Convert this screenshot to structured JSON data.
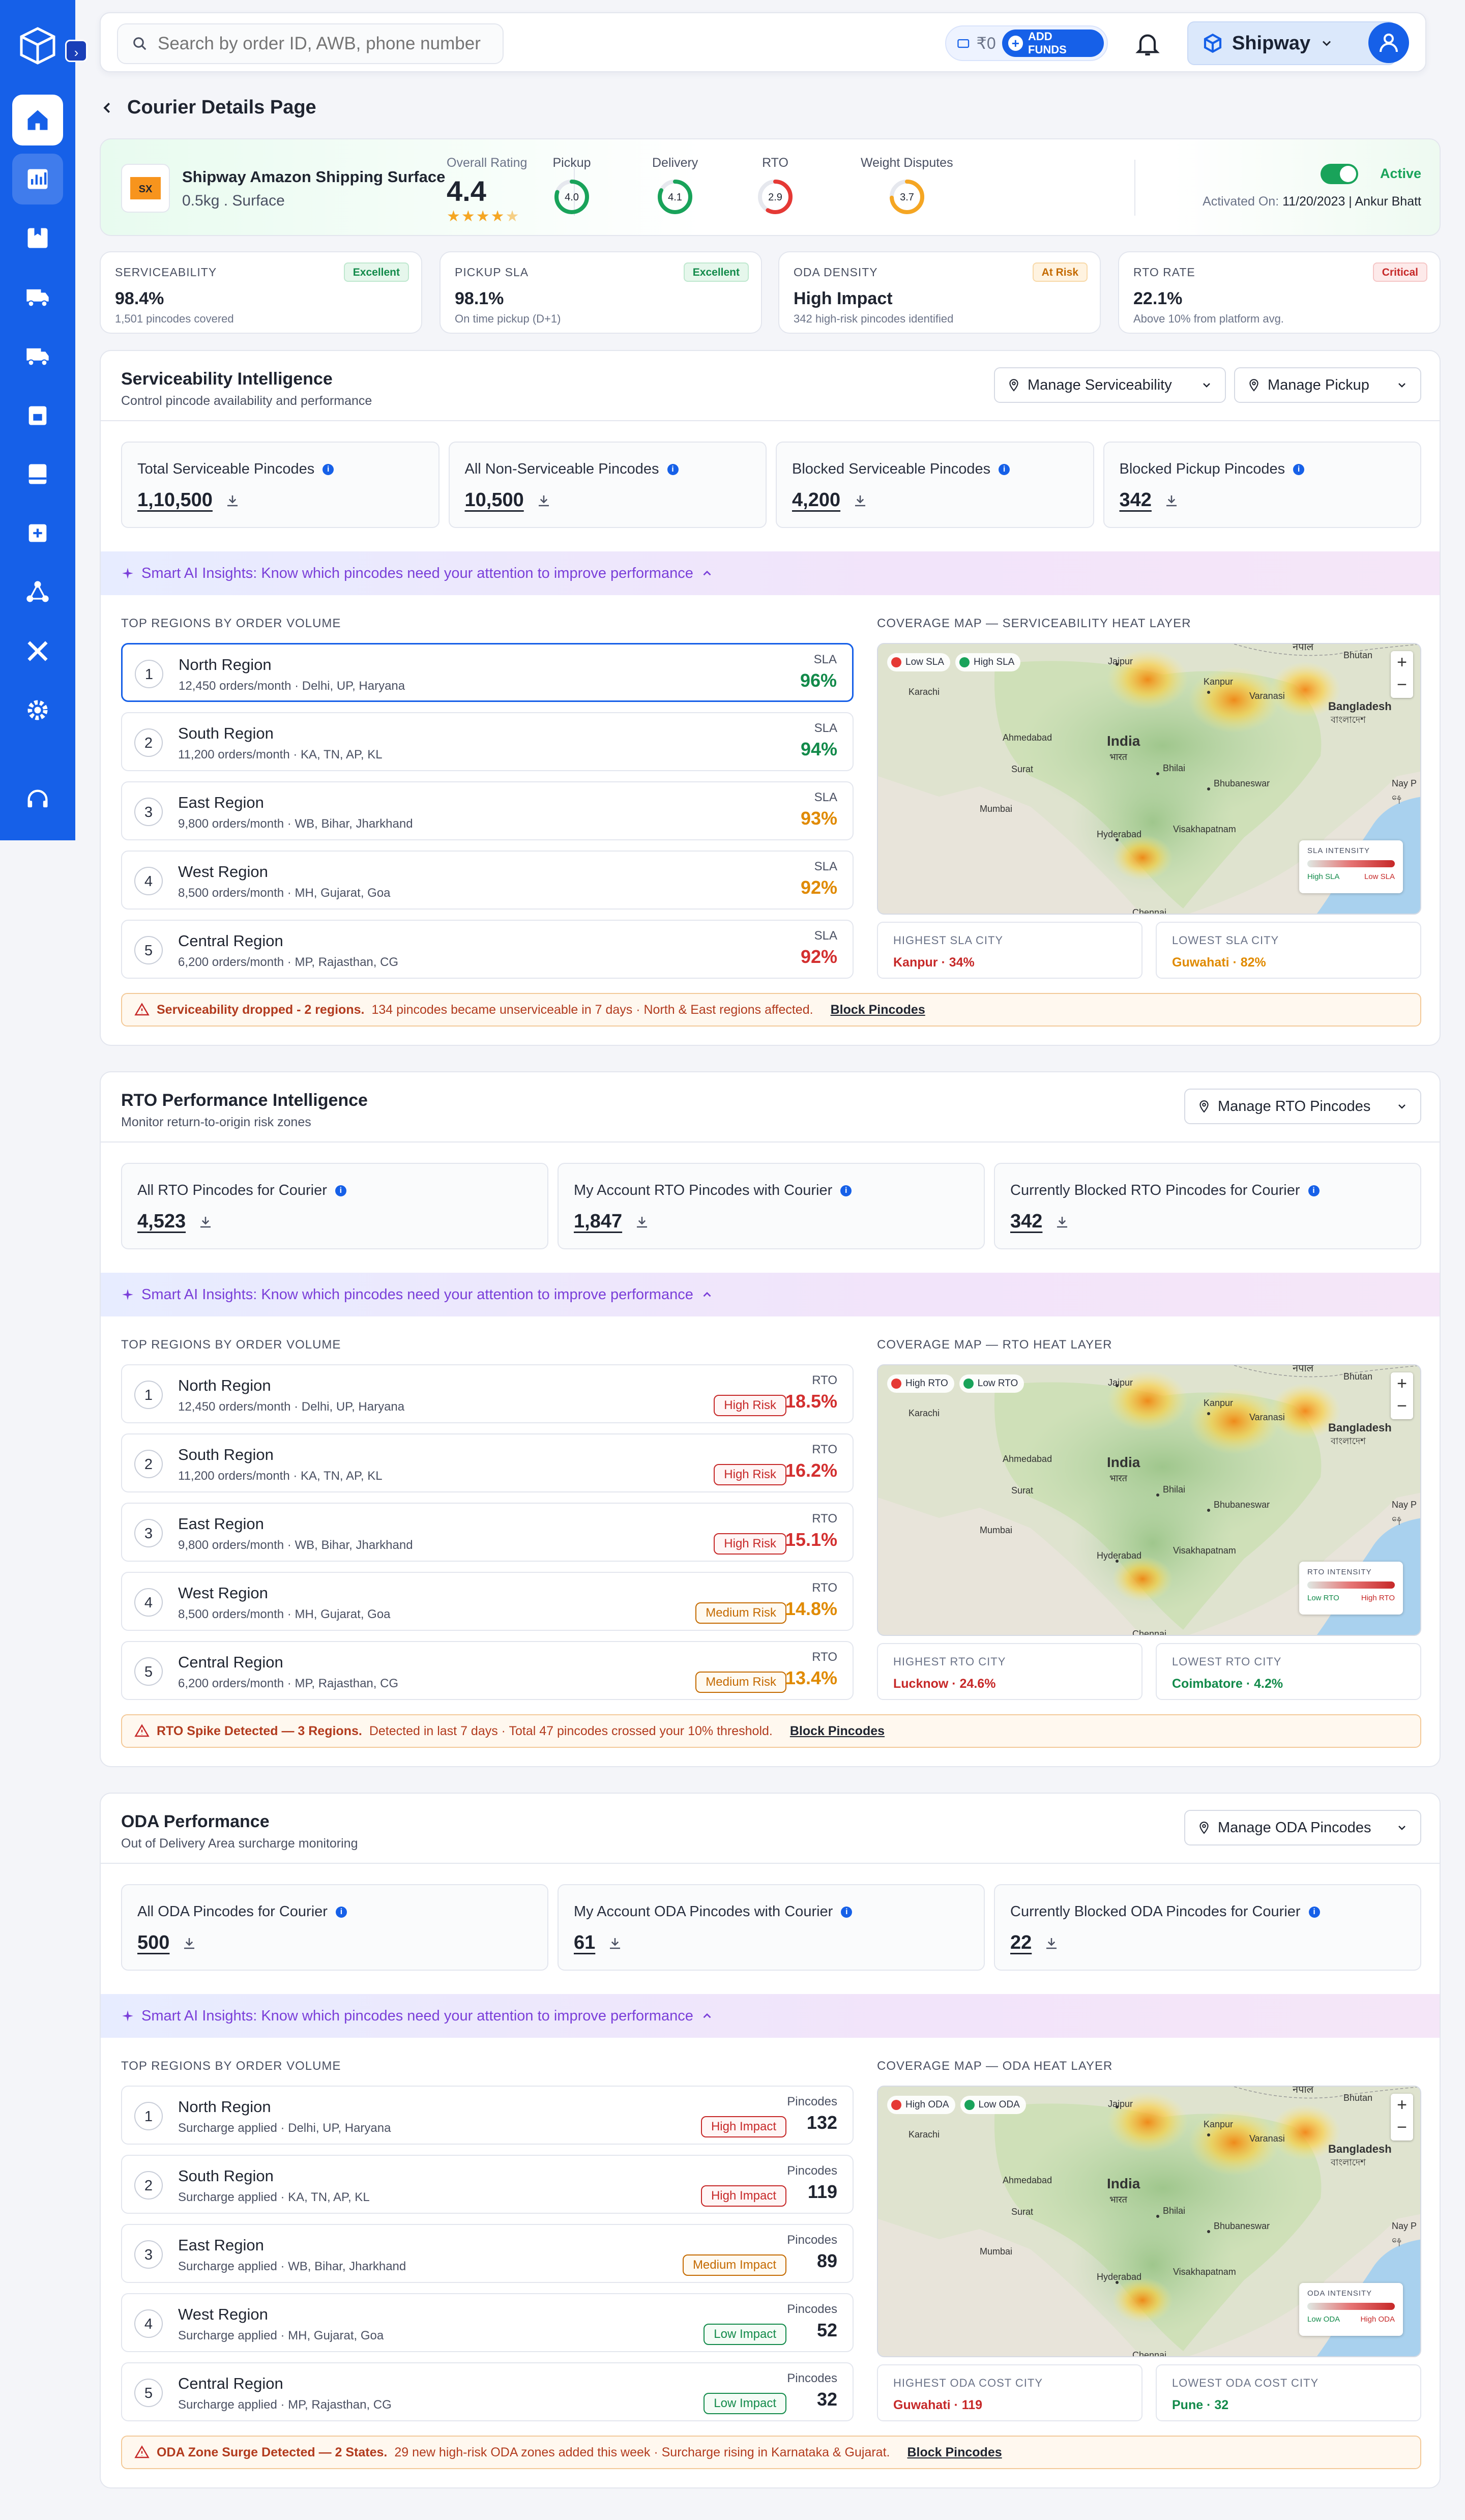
{
  "search": {
    "placeholder": "Search by order ID, AWB, phone number"
  },
  "header": {
    "wallet": "₹0",
    "add_funds": "ADD FUNDS",
    "brand": "Shipway"
  },
  "page_title": "Courier Details Page",
  "courier": {
    "name": "Shipway Amazon Shipping Surface",
    "meta": "0.5kg . Surface",
    "rating_label": "Overall Rating",
    "rating_value": "4.4",
    "rating_stars": 4.5,
    "gauges": [
      {
        "label": "Pickup",
        "value": "4.0",
        "level": 0.8,
        "color": "#19a35a"
      },
      {
        "label": "Delivery",
        "value": "4.1",
        "level": 0.82,
        "color": "#19a35a"
      },
      {
        "label": "RTO",
        "value": "2.9",
        "level": 0.58,
        "color": "#e53935"
      },
      {
        "label": "Weight Disputes",
        "value": "3.7",
        "level": 0.74,
        "color": "#f5a623"
      }
    ],
    "status": "Active",
    "activated_label": "Activated On:",
    "activated_value": "11/20/2023 | Ankur Bhatt"
  },
  "kpis": [
    {
      "title": "SERVICEABILITY",
      "badge": "Excellent",
      "value": "98.4%",
      "sub": "1,501 pincodes covered"
    },
    {
      "title": "PICKUP SLA",
      "badge": "Excellent",
      "value": "98.1%",
      "sub": "On time pickup (D+1)"
    },
    {
      "title": "ODA DENSITY",
      "badge": "At Risk",
      "value": "High Impact",
      "sub": "342 high-risk pincodes identified"
    },
    {
      "title": "RTO RATE",
      "badge": "Critical",
      "value": "22.1%",
      "sub": "Above 10% from platform avg."
    }
  ],
  "ai_text": "Smart AI Insights: Know which pincodes need your attention to improve performance",
  "regions_caption": "TOP REGIONS BY ORDER VOLUME",
  "map_labels": {
    "karachi": "Karachi",
    "jaipur": "Jaipur",
    "nepal": "नेपाल",
    "bhutan": "Bhutan",
    "bangladesh": "Bangladesh",
    "bangladesh_local": "বাংলাদেশ",
    "ahmedabad": "Ahmedabad",
    "india": "India",
    "india_local": "भारत",
    "surat": "Surat",
    "bhilai": "Bhilai",
    "bhubaneswar": "Bhubaneswar",
    "hyderabad": "Hyderabad",
    "visakhapatnam": "Visakhapatnam",
    "kanpur": "Kanpur",
    "varanasi": "Varanasi",
    "nay": "Nay P",
    "nay_local": "နေ",
    "mumbai": "Mumbai",
    "chennai": "Chennai"
  },
  "serviceability": {
    "title": "Serviceability Intelligence",
    "subtitle": "Control pincode availability and performance",
    "btn1": "Manage Serviceability",
    "btn2": "Manage Pickup",
    "stats": [
      {
        "label": "Total Serviceable Pincodes",
        "value": "1,10,500"
      },
      {
        "label": "All Non-Serviceable Pincodes",
        "value": "10,500"
      },
      {
        "label": "Blocked Serviceable Pincodes",
        "value": "4,200"
      },
      {
        "label": "Blocked Pickup Pincodes",
        "value": "342"
      }
    ],
    "map_caption": "COVERAGE MAP — SERVICEABILITY HEAT LAYER",
    "metric_label": "SLA",
    "rows": [
      {
        "n": "1",
        "name": "North Region",
        "sub": "12,450 orders/month · Delhi, UP, Haryana",
        "value": "96%",
        "color": "green"
      },
      {
        "n": "2",
        "name": "South Region",
        "sub": "11,200 orders/month · KA, TN, AP, KL",
        "value": "94%",
        "color": "green"
      },
      {
        "n": "3",
        "name": "East Region",
        "sub": "9,800 orders/month · WB, Bihar, Jharkhand",
        "value": "93%",
        "color": "orange"
      },
      {
        "n": "4",
        "name": "West Region",
        "sub": "8,500 orders/month · MH, Gujarat, Goa",
        "value": "92%",
        "color": "orange"
      },
      {
        "n": "5",
        "name": "Central Region",
        "sub": "6,200 orders/month · MP, Rajasthan, CG",
        "value": "92%",
        "color": "red"
      }
    ],
    "legend": [
      {
        "label": "Low SLA",
        "color": "#e53935"
      },
      {
        "label": "High SLA",
        "color": "#19a35a"
      }
    ],
    "intensity": {
      "title": "SLA INTENSITY",
      "lo": "High SLA",
      "hi": "Low SLA"
    },
    "city1": {
      "title": "HIGHEST SLA CITY",
      "value": "Kanpur · 34%",
      "color": "#c62828"
    },
    "city2": {
      "title": "LOWEST SLA CITY",
      "value": "Guwahati · 82%",
      "color": "#e08a00"
    },
    "alert_bold": "Serviceability dropped - 2 regions.",
    "alert_text": "134 pincodes became unserviceable in 7 days · North & East regions affected.",
    "alert_link": "Block Pincodes"
  },
  "rto": {
    "title": "RTO Performance Intelligence",
    "subtitle": "Monitor return-to-origin risk zones",
    "btn1": "Manage RTO Pincodes",
    "stats": [
      {
        "label": "All RTO Pincodes for Courier",
        "value": "4,523"
      },
      {
        "label": "My Account RTO Pincodes with Courier",
        "value": "1,847"
      },
      {
        "label": "Currently Blocked RTO Pincodes for Courier",
        "value": "342"
      }
    ],
    "map_caption": "COVERAGE MAP — RTO HEAT LAYER",
    "metric_label": "RTO",
    "rows": [
      {
        "n": "1",
        "name": "North Region",
        "sub": "12,450 orders/month · Delhi, UP, Haryana",
        "pill": "High Risk",
        "pillc": "red",
        "value": "18.5%",
        "color": "red"
      },
      {
        "n": "2",
        "name": "South Region",
        "sub": "11,200 orders/month · KA, TN, AP, KL",
        "pill": "High Risk",
        "pillc": "red",
        "value": "16.2%",
        "color": "red"
      },
      {
        "n": "3",
        "name": "East Region",
        "sub": "9,800 orders/month · WB, Bihar, Jharkhand",
        "pill": "High Risk",
        "pillc": "red",
        "value": "15.1%",
        "color": "red"
      },
      {
        "n": "4",
        "name": "West Region",
        "sub": "8,500 orders/month · MH, Gujarat, Goa",
        "pill": "Medium Risk",
        "pillc": "org",
        "value": "14.8%",
        "color": "orange"
      },
      {
        "n": "5",
        "name": "Central Region",
        "sub": "6,200 orders/month · MP, Rajasthan, CG",
        "pill": "Medium Risk",
        "pillc": "org",
        "value": "13.4%",
        "color": "orange"
      }
    ],
    "legend": [
      {
        "label": "High RTO",
        "color": "#e53935"
      },
      {
        "label": "Low RTO",
        "color": "#19a35a"
      }
    ],
    "intensity": {
      "title": "RTO INTENSITY",
      "lo": "Low RTO",
      "hi": "High RTO"
    },
    "city1": {
      "title": "HIGHEST RTO CITY",
      "value": "Lucknow · 24.6%",
      "color": "#c62828"
    },
    "city2": {
      "title": "LOWEST RTO CITY",
      "value": "Coimbatore · 4.2%",
      "color": "#128a4a"
    },
    "alert_bold": "RTO Spike Detected — 3 Regions.",
    "alert_text": "Detected in last 7 days · Total 47 pincodes crossed your 10% threshold.",
    "alert_link": "Block Pincodes"
  },
  "oda": {
    "title": "ODA Performance",
    "subtitle": "Out of Delivery Area surcharge monitoring",
    "btn1": "Manage ODA Pincodes",
    "stats": [
      {
        "label": "All ODA Pincodes for Courier",
        "value": "500"
      },
      {
        "label": "My Account ODA Pincodes with Courier",
        "value": "61"
      },
      {
        "label": "Currently Blocked ODA Pincodes for Courier",
        "value": "22"
      }
    ],
    "map_caption": "COVERAGE MAP — ODA HEAT LAYER",
    "metric_label": "Pincodes",
    "rows": [
      {
        "n": "1",
        "name": "North Region",
        "sub": "Surcharge applied · Delhi, UP, Haryana",
        "pill": "High Impact",
        "pillc": "red",
        "value": "132",
        "color": "dark"
      },
      {
        "n": "2",
        "name": "South Region",
        "sub": "Surcharge applied · KA, TN, AP, KL",
        "pill": "High Impact",
        "pillc": "red",
        "value": "119",
        "color": "dark"
      },
      {
        "n": "3",
        "name": "East Region",
        "sub": "Surcharge applied · WB, Bihar, Jharkhand",
        "pill": "Medium Impact",
        "pillc": "org",
        "value": "89",
        "color": "dark"
      },
      {
        "n": "4",
        "name": "West Region",
        "sub": "Surcharge applied · MH, Gujarat, Goa",
        "pill": "Low Impact",
        "pillc": "grn",
        "value": "52",
        "color": "dark"
      },
      {
        "n": "5",
        "name": "Central Region",
        "sub": "Surcharge applied · MP, Rajasthan, CG",
        "pill": "Low Impact",
        "pillc": "grn",
        "value": "32",
        "color": "dark"
      }
    ],
    "legend": [
      {
        "label": "High ODA",
        "color": "#e53935"
      },
      {
        "label": "Low ODA",
        "color": "#19a35a"
      }
    ],
    "intensity": {
      "title": "ODA INTENSITY",
      "lo": "Low ODA",
      "hi": "High ODA"
    },
    "city1": {
      "title": "HIGHEST ODA COST CITY",
      "value": "Guwahati · 119",
      "color": "#c62828"
    },
    "city2": {
      "title": "LOWEST ODA COST CITY",
      "value": "Pune · 32",
      "color": "#128a4a"
    },
    "alert_bold": "ODA Zone Surge Detected — 2 States.",
    "alert_text": "29 new high-risk ODA zones added this week · Surcharge rising in Karnataka & Gujarat.",
    "alert_link": "Block Pincodes"
  }
}
